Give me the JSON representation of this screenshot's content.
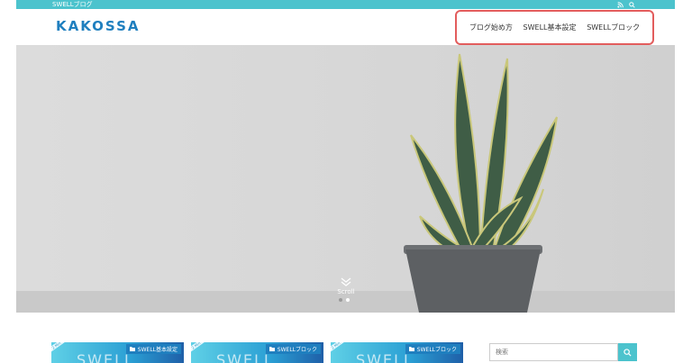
{
  "topbar": {
    "tagline": "SWELLブログ",
    "icons": [
      "rss-icon",
      "search-icon"
    ]
  },
  "header": {
    "logo": "KAKOSSA"
  },
  "nav": {
    "items": [
      {
        "label": "ブログ始め方"
      },
      {
        "label": "SWELL基本設定"
      },
      {
        "label": "SWELLブロック"
      }
    ]
  },
  "hero": {
    "scroll_label": "Scroll",
    "slides": 2,
    "active_slide": 2
  },
  "cards": [
    {
      "category": "SWELL基本設定",
      "ribbon": "2 Min",
      "art_text": "SWELL"
    },
    {
      "category": "SWELLブロック",
      "ribbon": "2 Min",
      "art_text": "SWELL"
    },
    {
      "category": "SWELLブロック",
      "ribbon": "2 Min",
      "art_text": "SWELL"
    }
  ],
  "sidebar": {
    "search": {
      "placeholder": "検索"
    }
  },
  "colors": {
    "accent": "#4cc3cd",
    "logo": "#1f7fbf",
    "highlight": "#e25d5d"
  }
}
